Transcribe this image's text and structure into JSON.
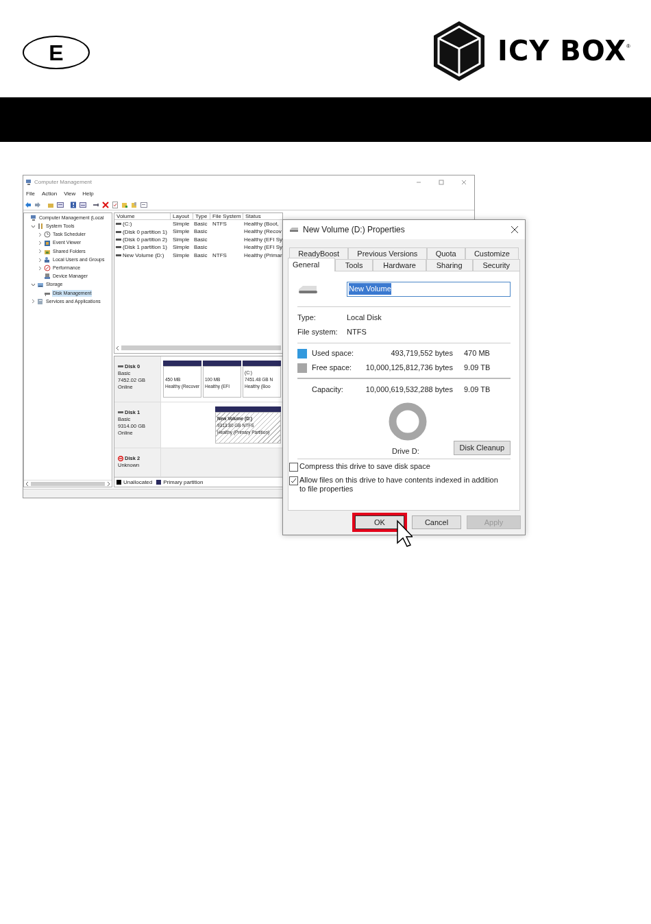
{
  "header": {
    "language_badge": "E",
    "logo": {
      "text": "ICY BOX",
      "mark": "®"
    }
  },
  "main_window": {
    "title": "Computer Management",
    "menu": [
      "File",
      "Action",
      "View",
      "Help"
    ],
    "tree": [
      {
        "label": "Computer Management (Local",
        "selected": false,
        "children": [
          {
            "label": "System Tools",
            "selected": false,
            "expanded": true,
            "children": [
              {
                "label": "Task Scheduler",
                "selected": false,
                "expanded": false
              },
              {
                "label": "Event Viewer",
                "selected": false,
                "expanded": false
              },
              {
                "label": "Shared Folders",
                "selected": false,
                "expanded": false
              },
              {
                "label": "Local Users and Groups",
                "selected": false,
                "expanded": false
              },
              {
                "label": "Performance",
                "selected": false,
                "expanded": false
              },
              {
                "label": "Device Manager",
                "selected": false
              }
            ]
          },
          {
            "label": "Storage",
            "selected": false,
            "expanded": true,
            "children": [
              {
                "label": "Disk Management",
                "selected": true
              }
            ]
          },
          {
            "label": "Services and Applications",
            "selected": false,
            "expanded": false
          }
        ]
      }
    ],
    "volume_table": {
      "columns": [
        "Volume",
        "Layout",
        "Type",
        "File System",
        "Status"
      ],
      "rows": [
        {
          "volume": "(C:)",
          "layout": "Simple",
          "type": "Basic",
          "file_system": "NTFS",
          "status": "Healthy (Boot,"
        },
        {
          "volume": "(Disk 0 partition 1)",
          "layout": "Simple",
          "type": "Basic",
          "status": "Healthy (Recov"
        },
        {
          "volume": "(Disk 0 partition 2)",
          "layout": "Simple",
          "type": "Basic",
          "status": "Healthy (EFI Sy"
        },
        {
          "volume": "(Disk 1 partition 1)",
          "layout": "Simple",
          "type": "Basic",
          "status": "Healthy (EFI Sy"
        },
        {
          "volume": "New Volume (D:)",
          "layout": "Simple",
          "type": "Basic",
          "file_system": "NTFS",
          "status": "Healthy (Primar"
        }
      ]
    },
    "disks": [
      {
        "name": "Disk 0",
        "kind": "online",
        "lines": [
          "Basic",
          "7452.02 GB",
          "Online"
        ],
        "partitions": [
          {
            "kind": "primary",
            "size": "450 MB",
            "status": "Healthy (Recover",
            "selected": false
          },
          {
            "kind": "primary",
            "size": "100 MB",
            "status": "Healthy (EFI",
            "selected": false
          },
          {
            "kind": "primary",
            "name": "(C:)",
            "size": "7451.48 GB N",
            "status": "Healthy (Boo",
            "selected": false
          }
        ]
      },
      {
        "name": "Disk 1",
        "kind": "online",
        "lines": [
          "Basic",
          "9314.00 GB",
          "Online"
        ],
        "partitions": [
          {
            "kind": "empty"
          },
          {
            "kind": "primary",
            "name": "New Volume  (D:)",
            "size": "9313.80 GB NTFS",
            "status": "Healthy (Primary Partition)",
            "selected": true
          }
        ]
      },
      {
        "name": "Disk 2",
        "kind": "error",
        "lines": [
          "Unknown"
        ]
      }
    ],
    "legend": [
      {
        "label": "Unallocated",
        "color": "#000000"
      },
      {
        "label": "Primary partition",
        "color": "#2b2b5e"
      }
    ]
  },
  "dialog": {
    "title": "New Volume (D:) Properties",
    "tab_rows": [
      [
        {
          "label": "ReadyBoost",
          "selected": false
        },
        {
          "label": "Previous Versions",
          "selected": false
        },
        {
          "label": "Quota",
          "selected": false
        },
        {
          "label": "Customize",
          "selected": false
        }
      ],
      [
        {
          "label": "General",
          "selected": true
        },
        {
          "label": "Tools",
          "selected": false
        },
        {
          "label": "Hardware",
          "selected": false
        },
        {
          "label": "Sharing",
          "selected": false
        },
        {
          "label": "Security",
          "selected": false
        }
      ]
    ],
    "name_field": {
      "value": "New Volume",
      "selected": true
    },
    "info": [
      {
        "label": "Type:",
        "value": "Local Disk"
      },
      {
        "label": "File system:",
        "value": "NTFS"
      }
    ],
    "space": [
      {
        "label": "Used space:",
        "bytes": "493,719,552 bytes",
        "size": "470 MB",
        "color": "#3399dd"
      },
      {
        "label": "Free space:",
        "bytes": "10,000,125,812,736 bytes",
        "size": "9.09 TB",
        "color": "#a6a6a6"
      }
    ],
    "capacity": {
      "label": "Capacity:",
      "bytes": "10,000,619,532,288 bytes",
      "size": "9.09 TB"
    },
    "drive_label": "Drive D:",
    "cleanup_button": "Disk Cleanup",
    "options": [
      {
        "label": "Compress this drive to save disk space",
        "checked": false
      },
      {
        "label": "Allow files on this drive to have contents indexed in addition to file properties",
        "checked": true
      }
    ],
    "buttons": [
      {
        "label": "OK",
        "highlighted": true,
        "disabled": false
      },
      {
        "label": "Cancel",
        "highlighted": false,
        "disabled": false
      },
      {
        "label": "Apply",
        "highlighted": false,
        "disabled": true
      }
    ]
  }
}
